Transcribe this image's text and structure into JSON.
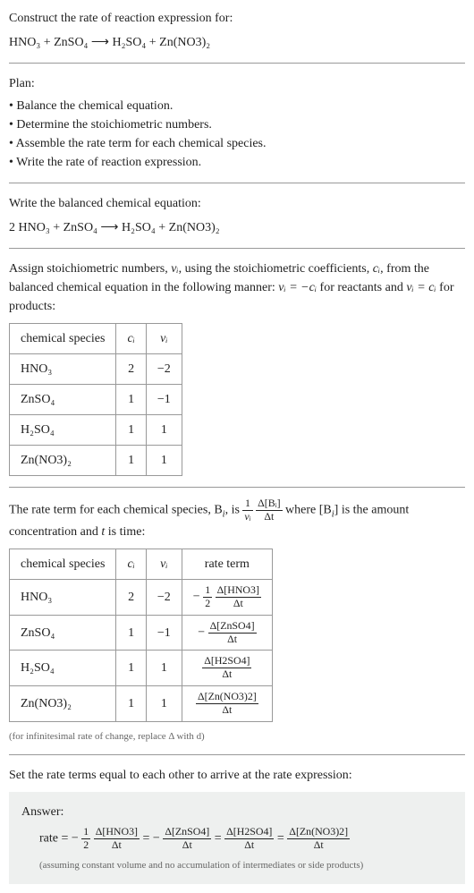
{
  "header": {
    "title": "Construct the rate of reaction expression for:",
    "equation": "HNO₃ + ZnSO₄ ⟶ H₂SO₄ + Zn(NO3)₂"
  },
  "plan": {
    "title": "Plan:",
    "items": [
      "• Balance the chemical equation.",
      "• Determine the stoichiometric numbers.",
      "• Assemble the rate term for each chemical species.",
      "• Write the rate of reaction expression."
    ]
  },
  "balanced": {
    "title": "Write the balanced chemical equation:",
    "equation": "2 HNO₃ + ZnSO₄ ⟶ H₂SO₄ + Zn(NO3)₂"
  },
  "stoich": {
    "intro_before": "Assign stoichiometric numbers, ",
    "nu": "νᵢ",
    "intro_mid": ", using the stoichiometric coefficients, ",
    "ci": "cᵢ",
    "intro_mid2": ", from the balanced chemical equation in the following manner: ",
    "rel1": "νᵢ = −cᵢ",
    "intro_mid3": " for reactants and ",
    "rel2": "νᵢ = cᵢ",
    "intro_end": " for products:",
    "headers": {
      "species": "chemical species",
      "ci": "cᵢ",
      "nu": "νᵢ"
    },
    "rows": [
      {
        "species": "HNO₃",
        "ci": "2",
        "nu": "−2"
      },
      {
        "species": "ZnSO₄",
        "ci": "1",
        "nu": "−1"
      },
      {
        "species": "H₂SO₄",
        "ci": "1",
        "nu": "1"
      },
      {
        "species": "Zn(NO3)₂",
        "ci": "1",
        "nu": "1"
      }
    ]
  },
  "rate_term": {
    "intro_a": "The rate term for each chemical species, B",
    "intro_b": ", is ",
    "frac1_num": "1",
    "frac1_den": "νᵢ",
    "frac2_num": "Δ[Bᵢ]",
    "frac2_den": "Δt",
    "intro_c": " where [B",
    "intro_d": "] is the amount concentration and ",
    "t": "t",
    "intro_e": " is time:",
    "headers": {
      "species": "chemical species",
      "ci": "cᵢ",
      "nu": "νᵢ",
      "rate": "rate term"
    },
    "rows": [
      {
        "species": "HNO₃",
        "ci": "2",
        "nu": "−2",
        "coef": "−",
        "fnum1": "1",
        "fden1": "2",
        "num": "Δ[HNO3]",
        "den": "Δt"
      },
      {
        "species": "ZnSO₄",
        "ci": "1",
        "nu": "−1",
        "coef": "−",
        "fnum1": "",
        "fden1": "",
        "num": "Δ[ZnSO4]",
        "den": "Δt"
      },
      {
        "species": "H₂SO₄",
        "ci": "1",
        "nu": "1",
        "coef": "",
        "fnum1": "",
        "fden1": "",
        "num": "Δ[H2SO4]",
        "den": "Δt"
      },
      {
        "species": "Zn(NO3)₂",
        "ci": "1",
        "nu": "1",
        "coef": "",
        "fnum1": "",
        "fden1": "",
        "num": "Δ[Zn(NO3)2]",
        "den": "Δt"
      }
    ],
    "note": "(for infinitesimal rate of change, replace Δ with d)"
  },
  "final": {
    "intro": "Set the rate terms equal to each other to arrive at the rate expression:",
    "answer_label": "Answer:",
    "rate_label": "rate = −",
    "f1num": "1",
    "f1den": "2",
    "t1num": "Δ[HNO3]",
    "t1den": "Δt",
    "eq1": " = −",
    "t2num": "Δ[ZnSO4]",
    "t2den": "Δt",
    "eq2": " = ",
    "t3num": "Δ[H2SO4]",
    "t3den": "Δt",
    "eq3": " = ",
    "t4num": "Δ[Zn(NO3)2]",
    "t4den": "Δt",
    "note": "(assuming constant volume and no accumulation of intermediates or side products)"
  }
}
